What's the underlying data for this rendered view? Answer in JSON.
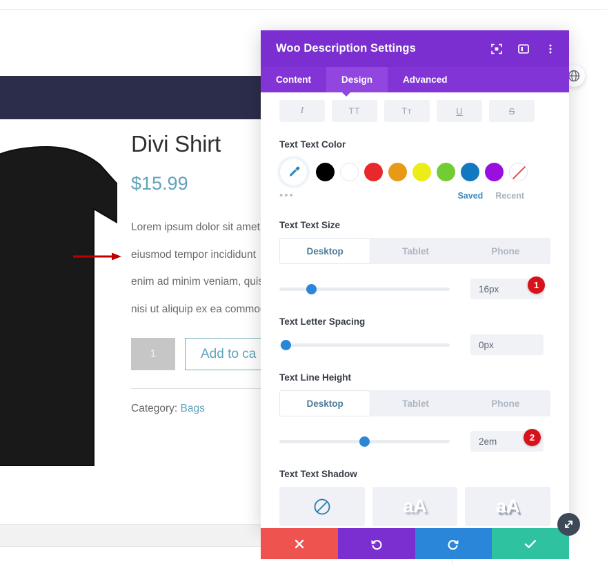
{
  "product": {
    "title": "Divi Shirt",
    "price": "$15.99",
    "description_lines": [
      "Lorem ipsum dolor sit amet",
      "eiusmod tempor incididunt",
      "enim ad minim veniam, quis",
      "nisi ut aliquip ex ea commod"
    ],
    "quantity": "1",
    "add_to_cart_label": "Add to ca",
    "category_prefix": "Category:",
    "category_value": "Bags",
    "search_icon": "magnifier-icon",
    "annotation_arrow": "red-arrow-annotation"
  },
  "modal": {
    "title": "Woo Description Settings",
    "header_icons": [
      {
        "name": "focus-expand-icon"
      },
      {
        "name": "layout-panel-icon"
      },
      {
        "name": "more-vertical-icon"
      }
    ],
    "tabs": [
      {
        "label": "Content",
        "active": false
      },
      {
        "label": "Design",
        "active": true
      },
      {
        "label": "Advanced",
        "active": false
      }
    ],
    "format_buttons": [
      {
        "name": "italic-button",
        "glyph": "I"
      },
      {
        "name": "uppercase-button",
        "glyph": "TT"
      },
      {
        "name": "capitalize-button",
        "glyph": "Tᴛ"
      },
      {
        "name": "underline-button",
        "glyph": "U"
      },
      {
        "name": "strikethrough-button",
        "glyph": "S"
      }
    ],
    "color_section": {
      "label": "Text Text Color",
      "eyedropper_icon": "eyedropper-icon",
      "swatches": [
        {
          "name": "swatch-black",
          "hex": "#000000"
        },
        {
          "name": "swatch-white",
          "hex": "#ffffff"
        },
        {
          "name": "swatch-red",
          "hex": "#e8282b"
        },
        {
          "name": "swatch-orange",
          "hex": "#e79a16"
        },
        {
          "name": "swatch-yellow",
          "hex": "#ecec19"
        },
        {
          "name": "swatch-green",
          "hex": "#72cd35"
        },
        {
          "name": "swatch-blue",
          "hex": "#1278c0"
        },
        {
          "name": "swatch-purple",
          "hex": "#9a0fe0"
        },
        {
          "name": "swatch-none",
          "hex": "transparent"
        }
      ],
      "more_dots": "•••",
      "saved_label": "Saved",
      "recent_label": "Recent"
    },
    "text_size": {
      "label": "Text Text Size",
      "devices": [
        {
          "label": "Desktop",
          "active": true
        },
        {
          "label": "Tablet",
          "active": false
        },
        {
          "label": "Phone",
          "active": false
        }
      ],
      "slider_percent": 17,
      "value": "16px",
      "badge": "1"
    },
    "letter_spacing": {
      "label": "Text Letter Spacing",
      "slider_percent": 1,
      "value": "0px"
    },
    "line_height": {
      "label": "Text Line Height",
      "devices": [
        {
          "label": "Desktop",
          "active": true
        },
        {
          "label": "Tablet",
          "active": false
        },
        {
          "label": "Phone",
          "active": false
        }
      ],
      "slider_percent": 50,
      "value": "2em",
      "badge": "2"
    },
    "text_shadow": {
      "label": "Text Text Shadow",
      "options": [
        {
          "name": "shadow-none-option",
          "glyph": ""
        },
        {
          "name": "shadow-soft-option",
          "glyph": "aA"
        },
        {
          "name": "shadow-hard-option",
          "glyph": "aA"
        }
      ]
    },
    "footer_buttons": [
      {
        "name": "cancel-button",
        "icon": "close-icon",
        "color": "#ef5350"
      },
      {
        "name": "undo-button",
        "icon": "undo-icon",
        "color": "#7b2fd1"
      },
      {
        "name": "redo-button",
        "icon": "redo-icon",
        "color": "#2a86d8"
      },
      {
        "name": "save-button",
        "icon": "check-icon",
        "color": "#2ec2a0"
      }
    ],
    "resize_handle_icon": "resize-diagonal-icon",
    "scrollbar": "panel-scrollbar"
  },
  "floating": {
    "icon": "globe-icon"
  }
}
